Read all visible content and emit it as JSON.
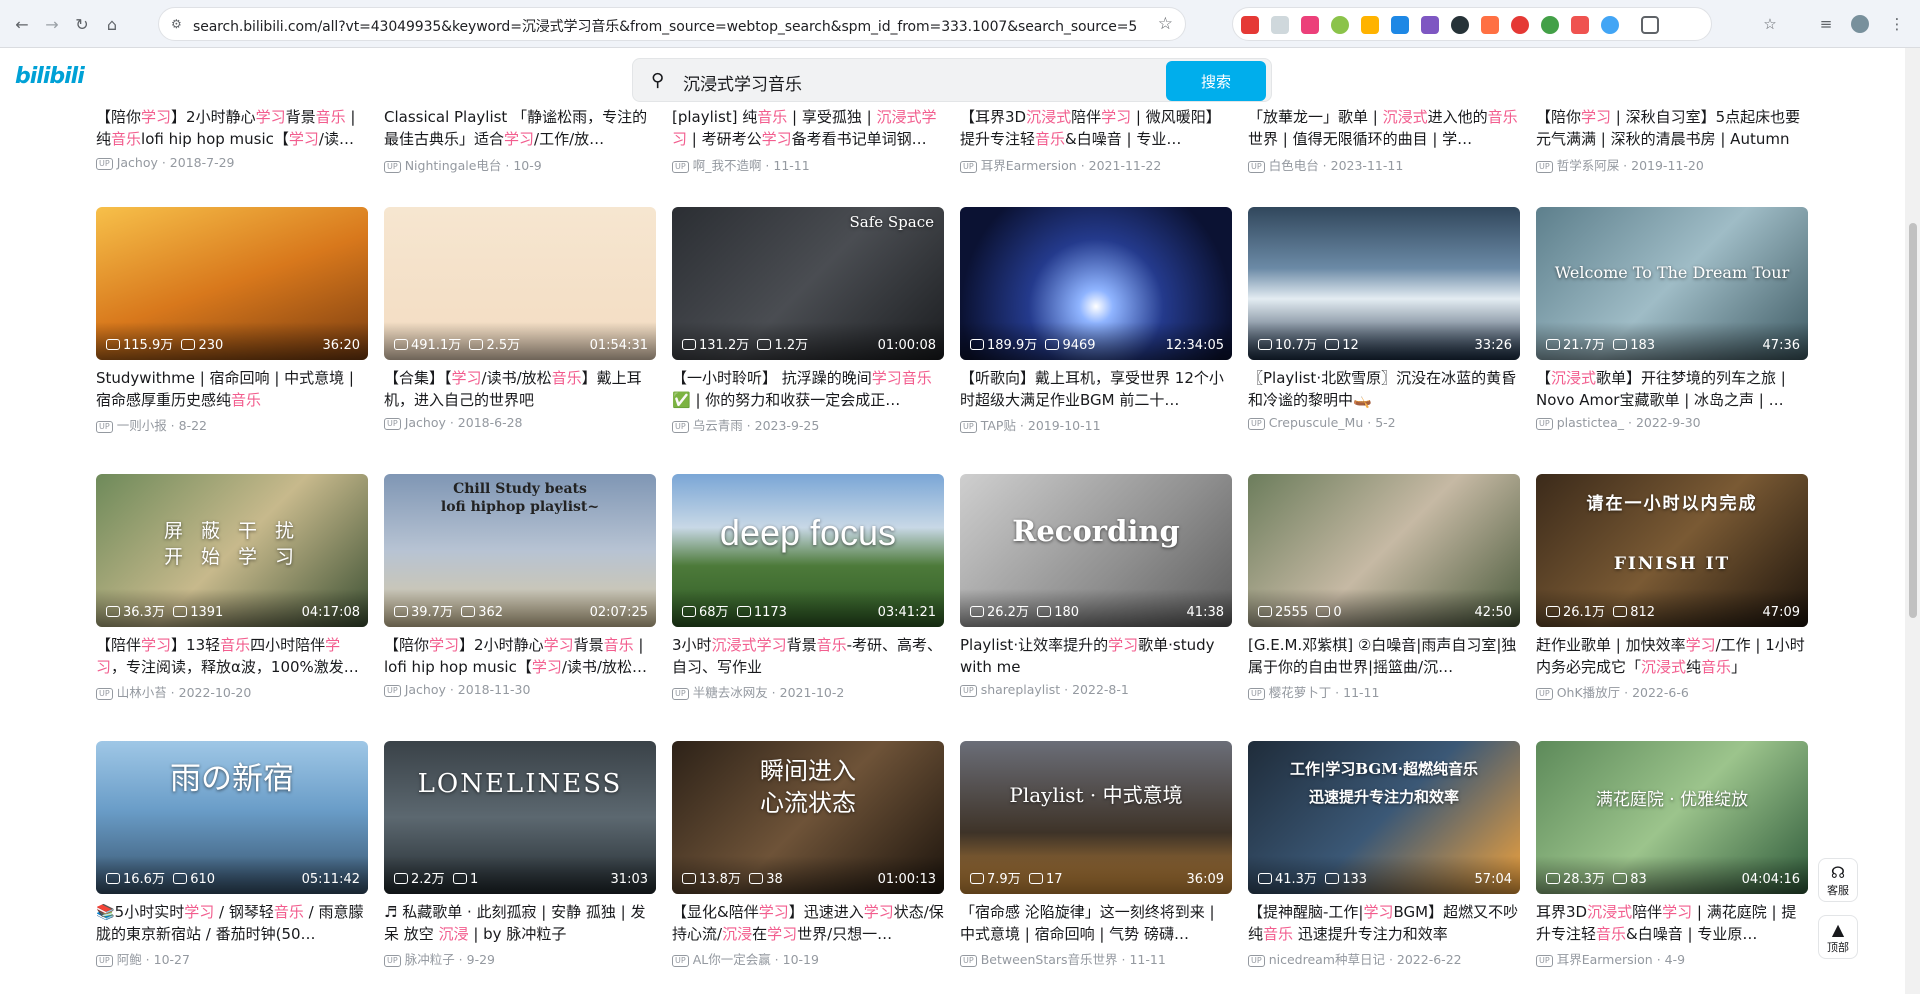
{
  "browser": {
    "url": "search.bilibili.com/all?vt=43049935&keyword=沉浸式学习音乐&from_source=webtop_search&spm_id_from=333.1007&search_source=5"
  },
  "site": {
    "logo": "bilibili",
    "search_query": "沉浸式学习音乐",
    "search_button": "搜索"
  },
  "floating": {
    "service": "客服",
    "top": "顶部"
  },
  "prev_row": [
    {
      "title": "【陪你学习】2小时静心学习背景音乐 | 纯音乐lofi hip hop music【学习/读…",
      "up": "Jachoy",
      "date": "2018-7-29"
    },
    {
      "title": "Classical Playlist 「静谧松雨，专注的最佳古典乐」适合学习/工作/放…",
      "up": "Nightingale电台",
      "date": "10-9"
    },
    {
      "title": "[playlist] 纯音乐 | 享受孤独 | 沉浸式学习 | 考研考公学习备考看书记单词钢…",
      "up": "啊_我不造啊",
      "date": "11-11"
    },
    {
      "title": "【耳界3D沉浸式陪伴学习 | 微风暖阳】提升专注轻音乐&白噪音 | 专业…",
      "up": "耳界Earmersion",
      "date": "2021-11-22"
    },
    {
      "title": "「放華龙一」歌单 | 沉浸式进入他的音乐世界 | 值得无限循环的曲目 | 学…",
      "up": "白色电台",
      "date": "2023-11-11"
    },
    {
      "title": "【陪你学习 | 深秋自习室】5点起床也要元气满满 | 深秋的清晨书房 | Autumn …",
      "up": "哲学系阿屎",
      "date": "2019-11-20"
    }
  ],
  "videos": [
    {
      "views": "115.9万",
      "danmaku": "230",
      "duration": "36:20",
      "title": "Studywithme | 宿命回响 | 中式意境 | 宿命感厚重历史感纯音乐",
      "up": "一则小报",
      "date": "8-22",
      "overlay": ""
    },
    {
      "views": "491.1万",
      "danmaku": "2.5万",
      "duration": "01:54:31",
      "title": "【合集】【学习/读书/放松音乐】戴上耳机，进入自己的世界吧",
      "up": "Jachoy",
      "date": "2018-6-28",
      "overlay": ""
    },
    {
      "views": "131.2万",
      "danmaku": "1.2万",
      "duration": "01:00:08",
      "title": "【一小时聆听】 抗浮躁的晚间学习音乐✅ | 你的努力和收获一定会成正…",
      "up": "乌云青雨",
      "date": "2023-9-25",
      "overlay": "Safe Space"
    },
    {
      "views": "189.9万",
      "danmaku": "9469",
      "duration": "12:34:05",
      "title": "【听歌向】戴上耳机，享受世界 12个小时超级大满足作业BGM 前二十…",
      "up": "TAP贴",
      "date": "2019-10-11",
      "overlay": ""
    },
    {
      "views": "10.7万",
      "danmaku": "12",
      "duration": "33:26",
      "title": "〖Playlist·北欧雪原〗沉没在冰蓝的黄昏和冷谧的黎明中🛶",
      "up": "Crepuscule_Mu",
      "date": "5-2",
      "overlay": ""
    },
    {
      "views": "21.7万",
      "danmaku": "183",
      "duration": "47:36",
      "title": "【沉浸式歌单】开往梦境的列车之旅 | Novo Amor宝藏歌单 | 冰岛之声 | …",
      "up": "plastictea_",
      "date": "2022-9-30",
      "overlay": "Welcome To The Dream Tour"
    },
    {
      "views": "36.3万",
      "danmaku": "1391",
      "duration": "04:17:08",
      "title": "【陪伴学习】13轻音乐四小时陪伴学习，专注阅读，释放α波，100%激发…",
      "up": "山林小苔",
      "date": "2022-10-20",
      "overlay": "屏 蔽 干 扰\n开 始 学 习"
    },
    {
      "views": "39.7万",
      "danmaku": "362",
      "duration": "02:07:25",
      "title": "【陪你学习】2小时静心学习背景音乐 | lofi hip hop music【学习/读书/放松…",
      "up": "Jachoy",
      "date": "2018-11-30",
      "overlay": "Chill Study beats\nlofi hiphop playlist~"
    },
    {
      "views": "68万",
      "danmaku": "1173",
      "duration": "03:41:21",
      "title": "3小时沉浸式学习背景音乐-考研、高考、自习、写作业",
      "up": "半糖去冰网友",
      "date": "2021-10-2",
      "overlay": "deep focus"
    },
    {
      "views": "26.2万",
      "danmaku": "180",
      "duration": "41:38",
      "title": "Playlist·让效率提升的学习歌单·study with me",
      "up": "shareplaylist",
      "date": "2022-8-1",
      "overlay": "Recording"
    },
    {
      "views": "2555",
      "danmaku": "0",
      "duration": "42:50",
      "title": "[G.E.M.邓紫棋] ②白噪音|雨声自习室|独属于你的自由世界|摇篮曲/沉…",
      "up": "樱花萝卜丁",
      "date": "11-11",
      "overlay": ""
    },
    {
      "views": "26.1万",
      "danmaku": "812",
      "duration": "47:09",
      "title": "赶作业歌单 | 加快效率学习/工作 | 1小时内务必完成它「沉浸式纯音乐」",
      "up": "OhK播放厅",
      "date": "2022-6-6",
      "overlay": "请在一小时以内完成\nFINISH IT"
    },
    {
      "views": "16.6万",
      "danmaku": "610",
      "duration": "05:11:42",
      "title": "📚5小时实时学习 / 钢琴轻音乐 / 雨意朦胧的東京新宿站 / 番茄时钟(50…",
      "up": "阿鲍",
      "date": "10-27",
      "overlay": "雨の新宿"
    },
    {
      "views": "2.2万",
      "danmaku": "1",
      "duration": "31:03",
      "title": "♬ 私藏歌单 · 此刻孤寂 | 安静 孤独 | 发呆 放空 沉浸 | by 脉冲粒子",
      "up": "脉冲粒子",
      "date": "9-29",
      "overlay": "LONELINESS"
    },
    {
      "views": "13.8万",
      "danmaku": "38",
      "duration": "01:00:13",
      "title": "【显化&陪伴学习】迅速进入学习状态/保持心流/沉浸在学习世界/只想一…",
      "up": "AL你一定会赢",
      "date": "10-19",
      "overlay": "瞬间进入\n心流状态"
    },
    {
      "views": "7.9万",
      "danmaku": "17",
      "duration": "36:09",
      "title": "「宿命感 沦陷旋律」这一刻终将到来 | 中式意境 | 宿命回响 | 气势 磅礴…",
      "up": "BetweenStars音乐世界",
      "date": "11-11",
      "overlay": "Playlist · 中式意境"
    },
    {
      "views": "41.3万",
      "danmaku": "133",
      "duration": "57:04",
      "title": "【提神醒脑-工作|学习BGM】超燃又不吵纯音乐 迅速提升专注力和效率",
      "up": "nicedream种草日记",
      "date": "2022-6-22",
      "overlay": "工作|学习BGM·超燃纯音乐\n迅速提升专注力和效率"
    },
    {
      "views": "28.3万",
      "danmaku": "83",
      "duration": "04:04:16",
      "title": "耳界3D沉浸式陪伴学习 | 满花庭院 | 提升专注轻音乐&白噪音 | 专业原…",
      "up": "耳界Earmersion",
      "date": "4-9",
      "overlay": "满花庭院 · 优雅绽放"
    }
  ],
  "colors": {
    "accent": "#00aeec",
    "highlight": "#f25d8e",
    "text": "#18191c",
    "meta": "#9499a0"
  }
}
